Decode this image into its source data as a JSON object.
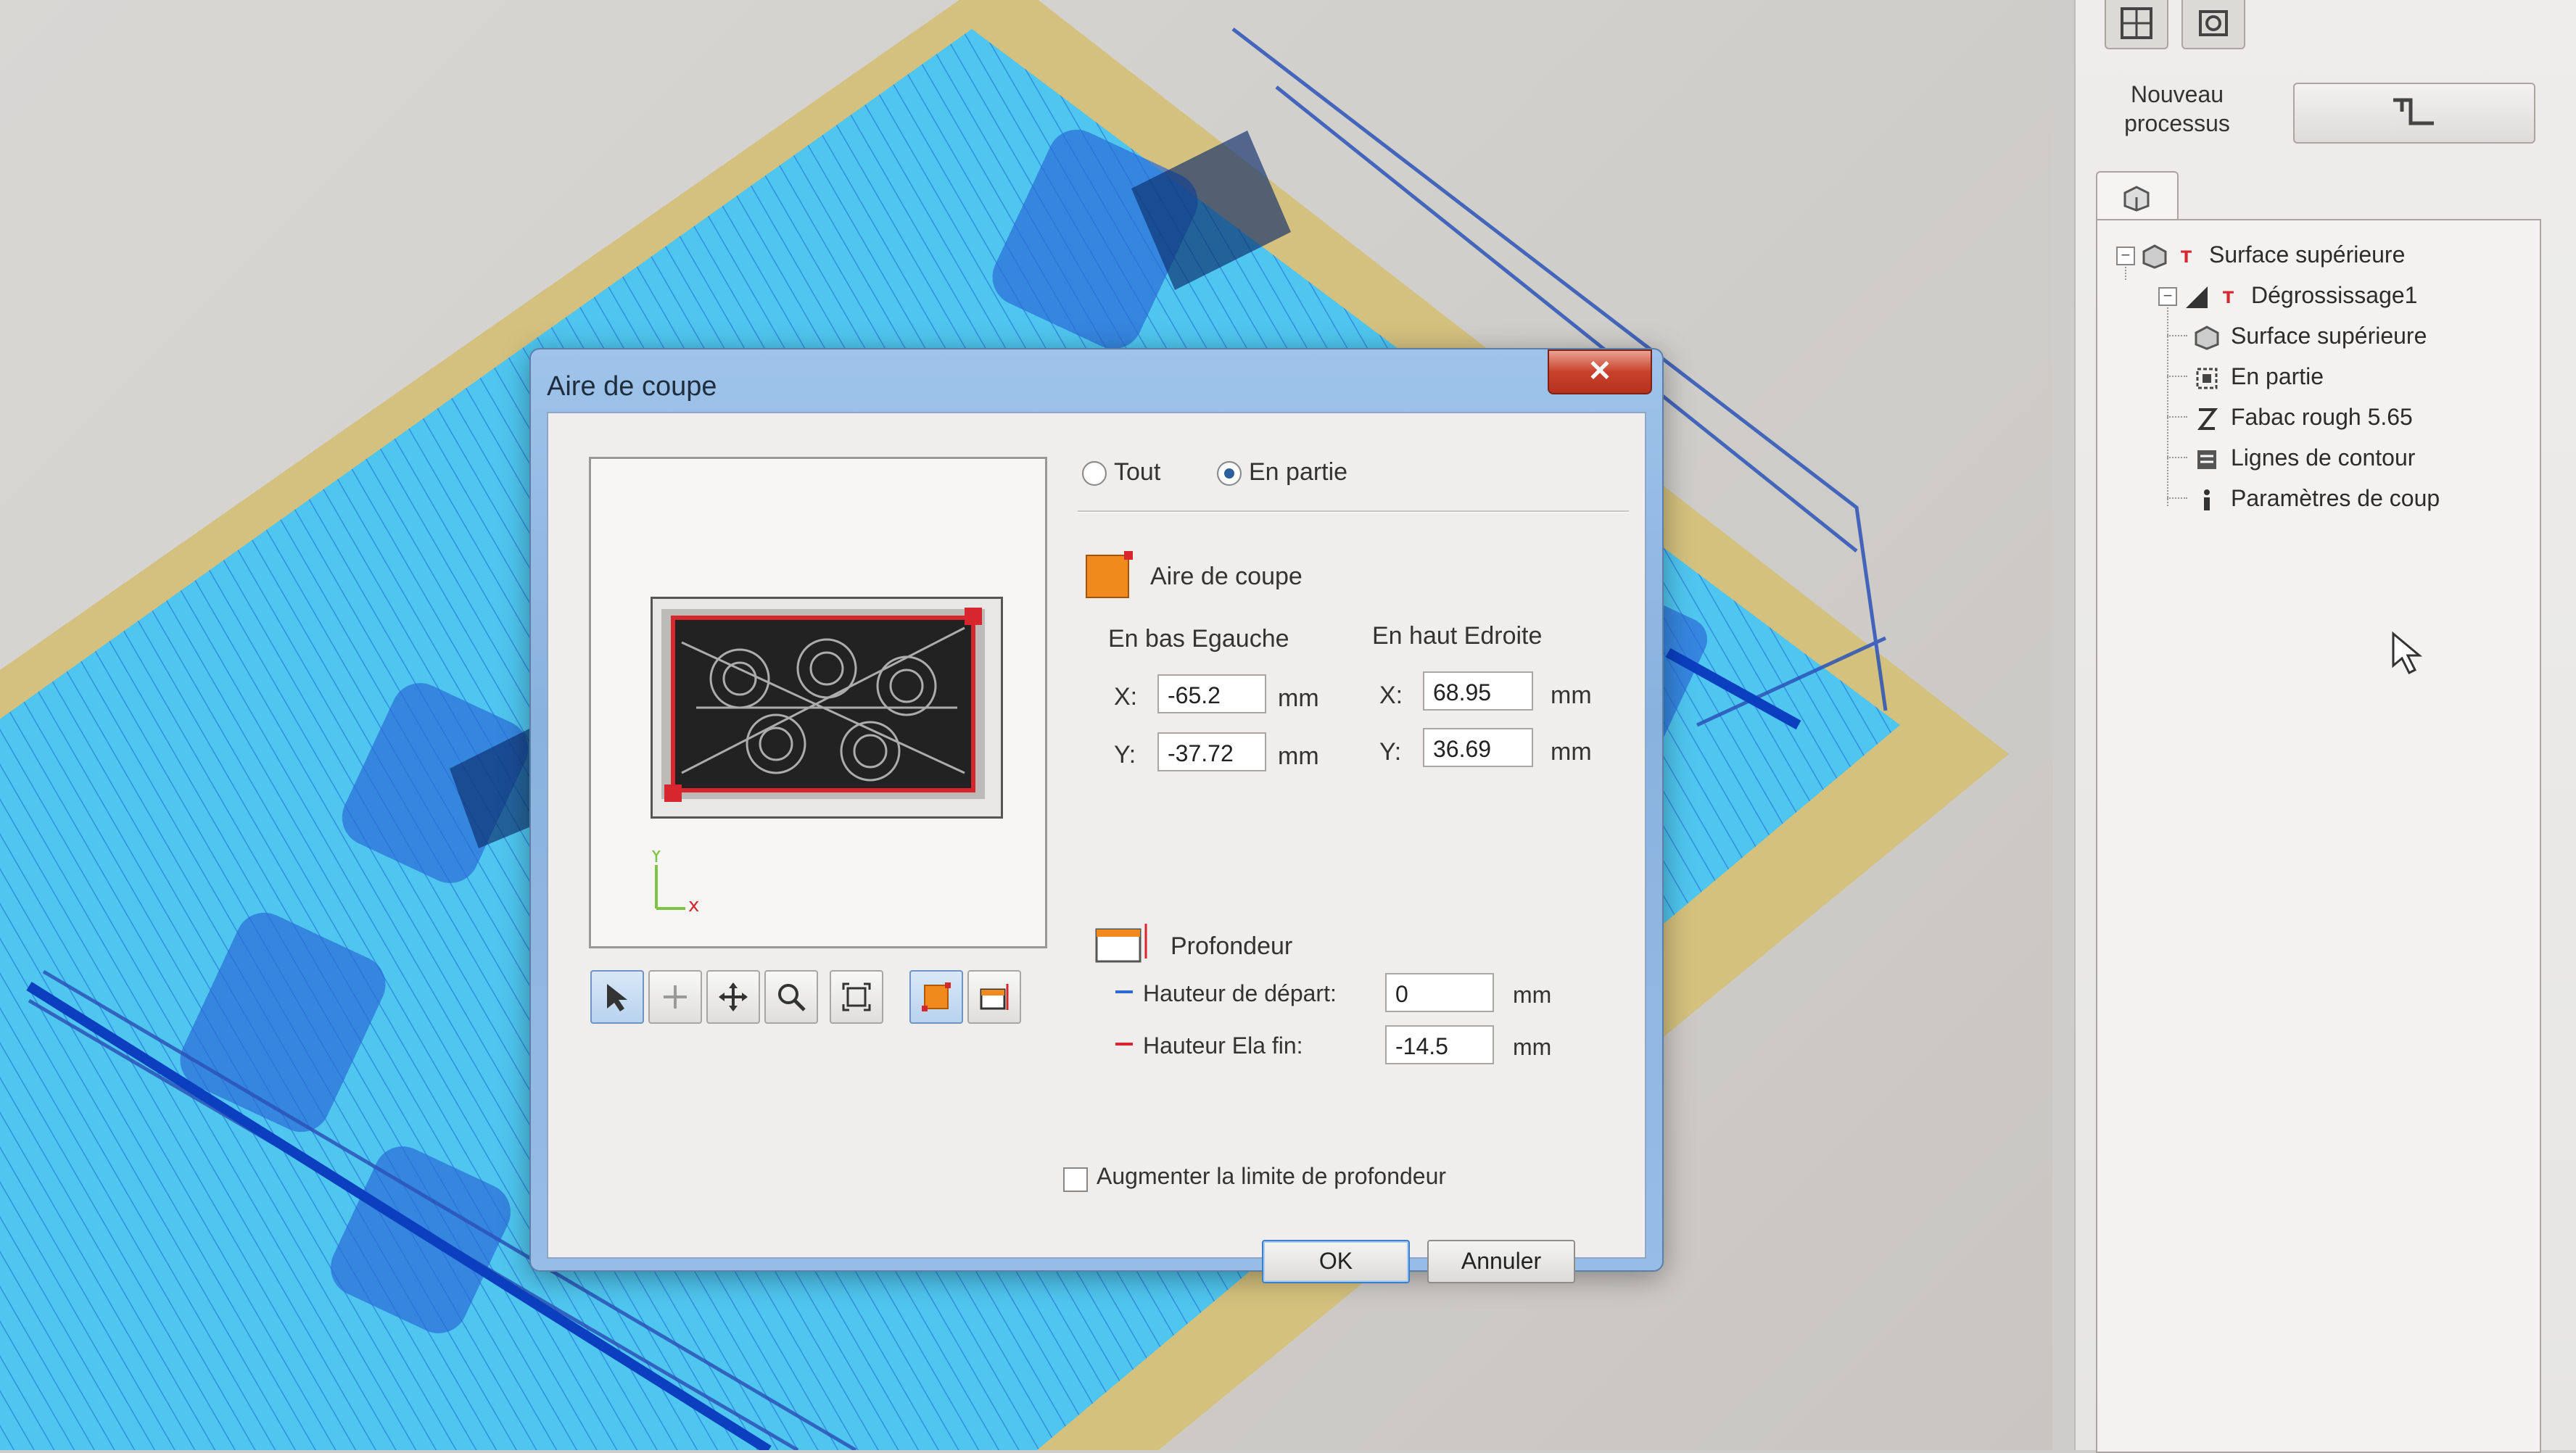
{
  "right_panel": {
    "new_process_label": "Nouveau processus",
    "tree": [
      {
        "label": "Surface supérieure",
        "icon": "surface-icon"
      },
      {
        "label": "Dégrossissage1",
        "icon": "roughing-icon"
      },
      {
        "label": "Surface supérieure",
        "icon": "surface-icon"
      },
      {
        "label": "En partie",
        "icon": "area-icon"
      },
      {
        "label": "Fabac rough 5.65",
        "icon": "tool-icon"
      },
      {
        "label": "Lignes de contour",
        "icon": "contour-icon"
      },
      {
        "label": "Paramètres de coup",
        "icon": "info-icon"
      }
    ]
  },
  "dialog": {
    "title": "Aire de coupe",
    "close_label": "✕",
    "radio_all": "Tout",
    "radio_partial": "En partie",
    "selected_radio": "En partie",
    "area_section_label": "Aire de coupe",
    "bottom_left_label": "En bas Egauche",
    "top_right_label": "En haut Edroite",
    "x_label": "X:",
    "y_label": "Y:",
    "unit": "mm",
    "bottom_left_x": "-65.2",
    "bottom_left_y": "-37.72",
    "top_right_x": "68.95",
    "top_right_y": "36.69",
    "depth_label": "Profondeur",
    "start_height_label": "Hauteur de départ:",
    "start_height_value": "0",
    "end_height_label": "Hauteur Ela fin:",
    "end_height_value": "-14.5",
    "increase_depth_label": "Augmenter la limite de profondeur",
    "increase_depth_checked": false,
    "ok_label": "OK",
    "cancel_label": "Annuler",
    "axis_x_label": "x",
    "axis_y_label": "Y"
  },
  "colors": {
    "dialog_frame": "#9fc3ea",
    "close_button": "#c8412b",
    "area_orange": "#f08a1c",
    "boundary_red": "#d8262f",
    "toolpath_blue": "#1f5fd6",
    "stock_cyan": "#4fc6ef",
    "stock_border_tan": "#d4c07a"
  }
}
